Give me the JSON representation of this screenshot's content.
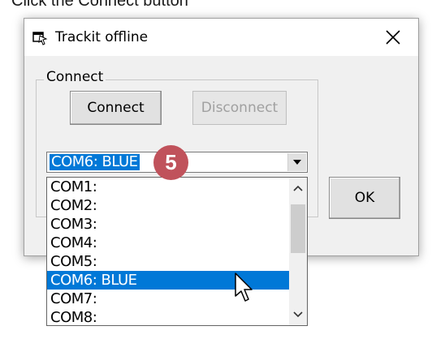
{
  "background_text": "Click the Connect button",
  "window": {
    "title": "Trackit offline",
    "close_label": "Close"
  },
  "connect_group": {
    "label": "Connect",
    "connect_button": "Connect",
    "disconnect_button": "Disconnect",
    "disconnect_enabled": false
  },
  "port_select": {
    "value": "COM6: BLUE",
    "options": [
      "COM1:",
      "COM2:",
      "COM3:",
      "COM4:",
      "COM5:",
      "COM6: BLUE",
      "COM7:",
      "COM8:"
    ],
    "selected_index": 5
  },
  "ok_button": "OK",
  "step_badge": "5",
  "colors": {
    "selection": "#0078d7",
    "badge": "#c0525b",
    "dialog_bg": "#f0f0f0"
  }
}
